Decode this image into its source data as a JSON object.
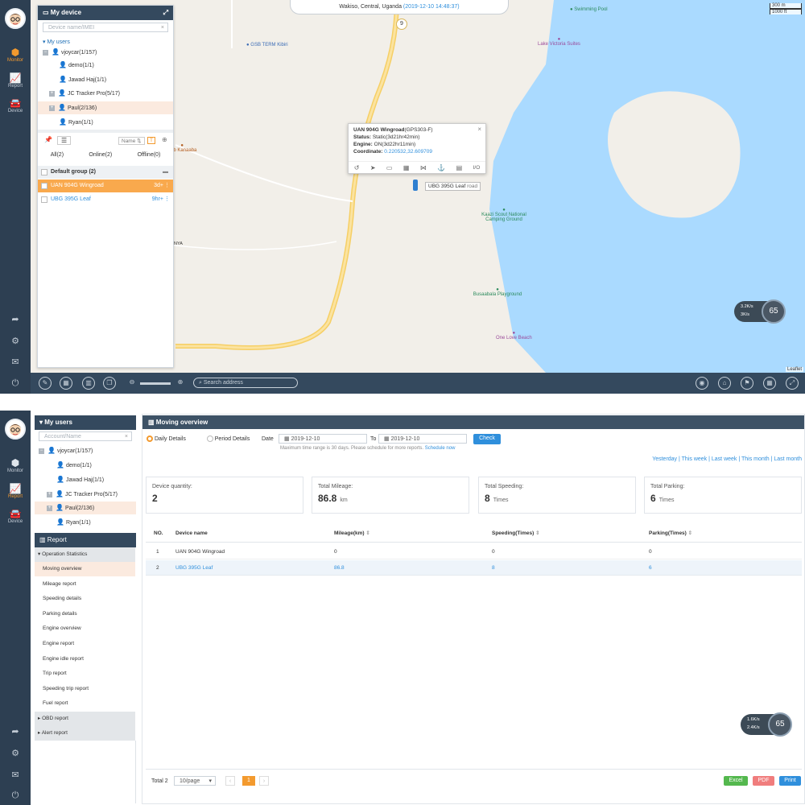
{
  "screen1": {
    "nav": {
      "monitor": "Monitor",
      "report": "Report",
      "device": "Device"
    },
    "panel": {
      "title": "My device",
      "search_placeholder": "Device name/IMEI",
      "my_users": "My users",
      "tree": [
        {
          "label": "vjoycar(1/157)"
        },
        {
          "label": "demo(1/1)"
        },
        {
          "label": "Jawad Haj(1/1)"
        },
        {
          "label": "JC Tracker Pro(5/17)"
        },
        {
          "label": "Paul(2/136)"
        },
        {
          "label": "Ryan(1/1)"
        }
      ],
      "sort_label": "Name",
      "tabs": [
        "All(2)",
        "Online(2)",
        "Offline(0)"
      ],
      "group": "Default group (2)",
      "devices": [
        {
          "name": "UAN 904G Wingroad",
          "time": "3d+"
        },
        {
          "name": "UBG 395G Leaf",
          "time": "9hr+"
        }
      ]
    },
    "location_bar": {
      "place": "Wakiso, Central, Uganda",
      "time": "(2019-12-10 14:48:37)"
    },
    "scale": {
      "m": "300 m",
      "ft": "1000 ft"
    },
    "road_badge": "9",
    "pois": [
      "GSB TERM Kibiri",
      "Swimming Pool",
      "Lake Victoria Suites",
      "Pub Kanaaba",
      "Kaazi Scout National Camping Ground",
      "Busaabala Playground",
      "One Love Beach"
    ],
    "road_text": "NYA",
    "popup": {
      "name": "UAN 904G Wingroad",
      "model": "(GPS303-F)",
      "status_k": "Status:",
      "status_v": "Static(3d21hr42min)",
      "engine_k": "Engine:",
      "engine_v": "ON(3d22hr11min)",
      "coord_k": "Coordinate:",
      "coord_v": "0.220532,32.609709",
      "io": "I/O"
    },
    "marker_label": "UBG 395G Leaf",
    "marker_label2": "road",
    "speed": {
      "v1": "3.2",
      "u1": "K/s",
      "v2": "3",
      "u2": "K/s",
      "dial": "65"
    },
    "attribution": "Leaflet",
    "search_address": "Search address"
  },
  "screen2": {
    "nav": {
      "monitor": "Monitor",
      "report": "Report",
      "device": "Device"
    },
    "panel_title": "My users",
    "search_placeholder": "Account/Name",
    "tree": [
      {
        "label": "vjoycar(1/157)"
      },
      {
        "label": "demo(1/1)"
      },
      {
        "label": "Jawad Haj(1/1)"
      },
      {
        "label": "JC Tracker Pro(5/17)"
      },
      {
        "label": "Paul(2/136)"
      },
      {
        "label": "Ryan(1/1)"
      }
    ],
    "report_title": "Report",
    "report_groups": {
      "op": "Operation Statistics",
      "obd": "OBD report",
      "alert": "Alert report"
    },
    "report_items": [
      "Moving overview",
      "Mileage report",
      "Speeding details",
      "Parking details",
      "Engine overview",
      "Engine report",
      "Engine idle report",
      "Trip report",
      "Speeding trip report",
      "Fuel report"
    ],
    "page_title": "Moving overview",
    "filters": {
      "daily": "Daily Details",
      "period": "Period Details",
      "date": "Date",
      "from": "2019-12-10",
      "to_label": "To",
      "to": "2019-12-10",
      "check": "Check",
      "note": "Maximum time range is 30 days. Please schedule for more reports.",
      "schedule": "Schedule now"
    },
    "quick": [
      "Yesterday",
      "This week",
      "Last week",
      "This month",
      "Last month"
    ],
    "cards": [
      {
        "title": "Device quantity:",
        "value": "2",
        "unit": ""
      },
      {
        "title": "Total Mileage:",
        "value": "86.8",
        "unit": "km"
      },
      {
        "title": "Total Speeding:",
        "value": "8",
        "unit": "Times"
      },
      {
        "title": "Total Parking:",
        "value": "6",
        "unit": "Times"
      }
    ],
    "columns": [
      "NO.",
      "Device name",
      "Mileage(km)",
      "Speeding(Times)",
      "Parking(Times)"
    ],
    "rows": [
      [
        "1",
        "UAN 904G Wingroad",
        "0",
        "0",
        "0"
      ],
      [
        "2",
        "UBG 395G Leaf",
        "86.8",
        "8",
        "6"
      ]
    ],
    "footer": {
      "total": "Total 2",
      "per_page": "10/page",
      "page": "1",
      "excel": "Excel",
      "pdf": "PDF",
      "print": "Print"
    },
    "speed": {
      "v1": "1.6",
      "u1": "K/s",
      "v2": "2.4",
      "u2": "K/s",
      "dial": "65"
    }
  }
}
